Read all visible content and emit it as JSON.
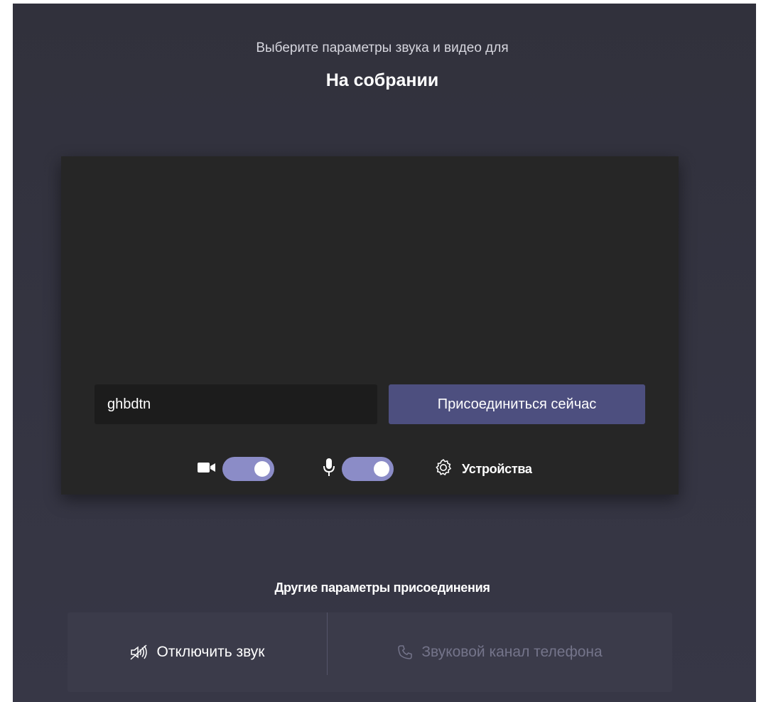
{
  "header": {
    "subtitle": "Выберите параметры звука и видео для",
    "title": "На собрании"
  },
  "preview": {
    "name_input_value": "ghbdtn",
    "join_label": "Присоединиться сейчас",
    "camera_on": true,
    "mic_on": true,
    "devices_label": "Устройства"
  },
  "other": {
    "heading": "Другие параметры присоединения",
    "mute_label": "Отключить звук",
    "phone_label": "Звуковой канал телефона"
  },
  "colors": {
    "background": "#33333f",
    "accent": "#4d4f7f",
    "toggle_on": "#8b8cc7",
    "disabled_text": "#74748a"
  },
  "icons": {
    "camera": "camera-icon",
    "mic": "microphone-icon",
    "settings": "gear-icon",
    "mute": "speaker-off-icon",
    "phone": "phone-icon"
  }
}
